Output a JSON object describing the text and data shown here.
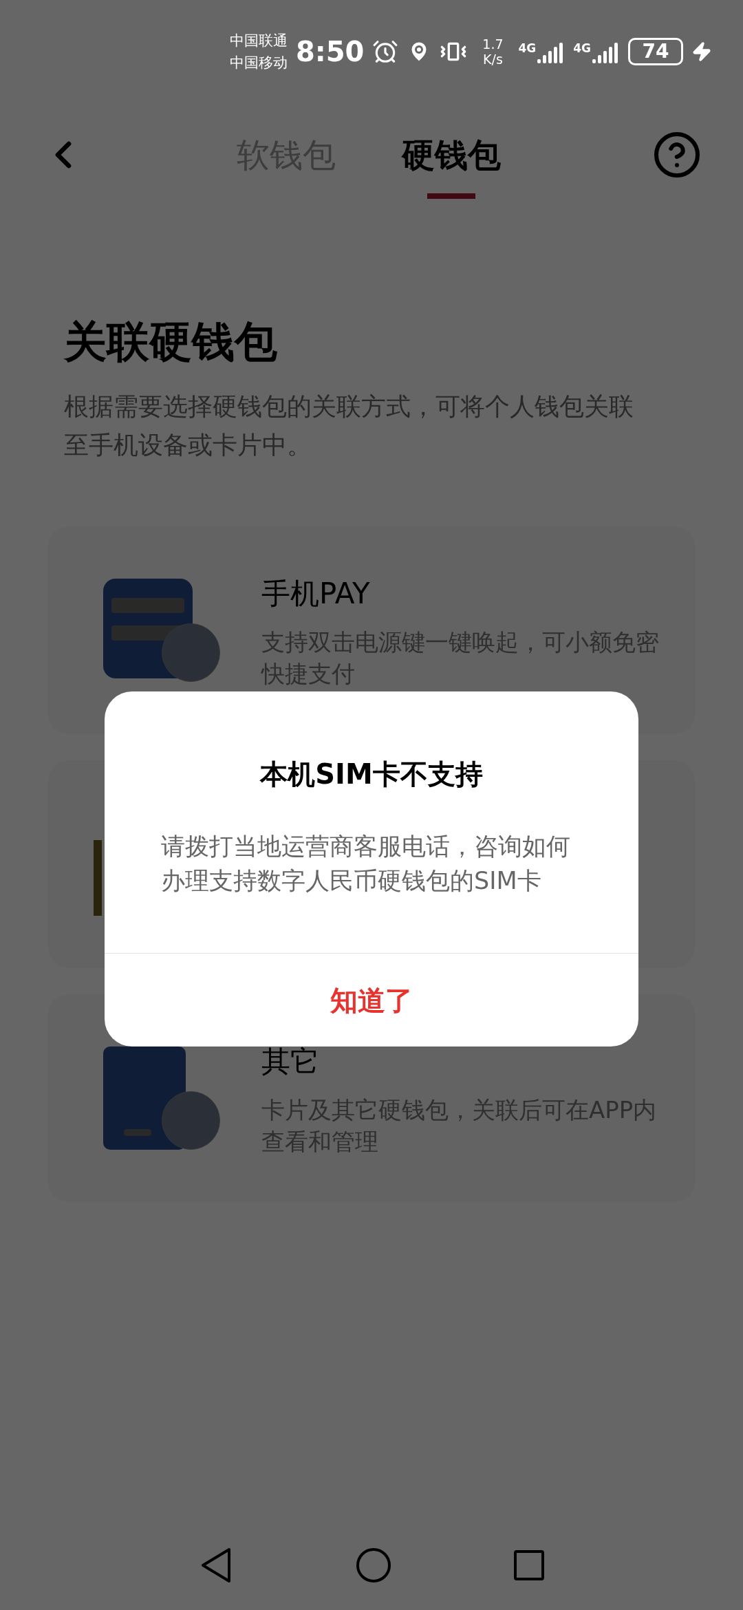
{
  "status_bar": {
    "carriers": [
      "中国联通",
      "中国移动"
    ],
    "time": "8:50",
    "speed": "1.7 K/s",
    "networks": [
      "4G",
      "4G"
    ],
    "battery": "74"
  },
  "tabs": [
    {
      "label": "软钱包",
      "selected": false
    },
    {
      "label": "硬钱包",
      "selected": true
    }
  ],
  "title": "关联硬钱包",
  "description": "根据需要选择硬钱包的关联方式，可将个人钱包关联至手机设备或卡片中。",
  "options": [
    {
      "kind": "phone",
      "title": "手机PAY",
      "description": "支持双击电源键一键唤起，可小额免密快捷支付"
    },
    {
      "kind": "sim"
    },
    {
      "kind": "card",
      "title": "其它",
      "description": "卡片及其它硬钱包，关联后可在APP内查看和管理"
    }
  ],
  "dialog": {
    "title": "本机SIM卡不支持",
    "message": "请拨打当地运营商客服电话，咨询如何办理支持数字人民币硬钱包的SIM卡",
    "button": "知道了"
  }
}
